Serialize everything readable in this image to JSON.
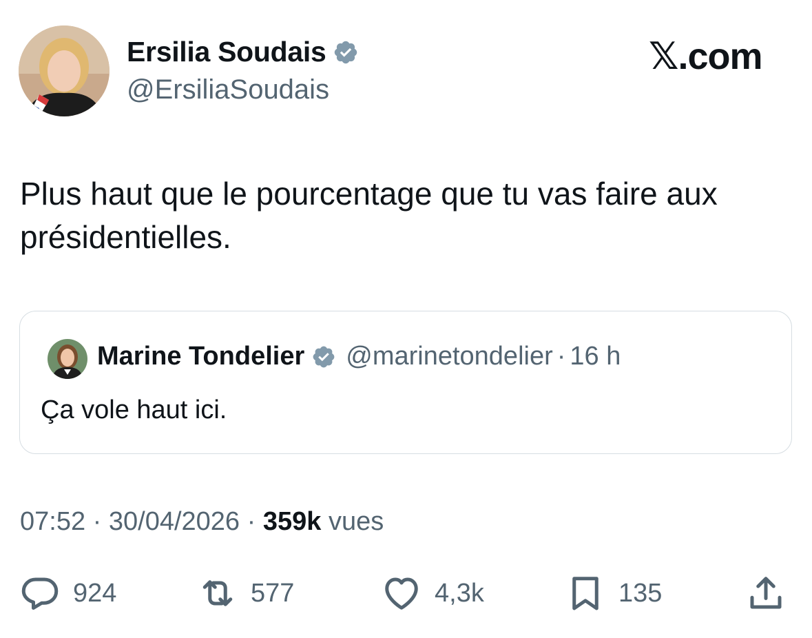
{
  "author": {
    "name": "Ersilia Soudais",
    "handle": "@ErsiliaSoudais"
  },
  "brand": "𝕏.com",
  "tweet": {
    "text": "Plus haut que le pourcentage que tu vas faire aux présidentielles."
  },
  "quote": {
    "name": "Marine Tondelier",
    "handle": "@marinetondelier",
    "separator": "·",
    "time": "16 h",
    "text": "Ça vole haut ici."
  },
  "meta": {
    "time": "07:52",
    "sep1": " · ",
    "date": "30/04/2026",
    "sep2": " · ",
    "views": "359k",
    "views_label": " vues"
  },
  "actions": {
    "replies": "924",
    "retweets": "577",
    "likes": "4,3k",
    "bookmarks": "135"
  },
  "colors": {
    "text": "#0f1419",
    "secondary": "#536471",
    "verified": "#829aab",
    "border": "#d6dde2"
  },
  "icons": [
    "verified-icon",
    "reply-icon",
    "retweet-icon",
    "like-icon",
    "bookmark-icon",
    "share-icon"
  ]
}
